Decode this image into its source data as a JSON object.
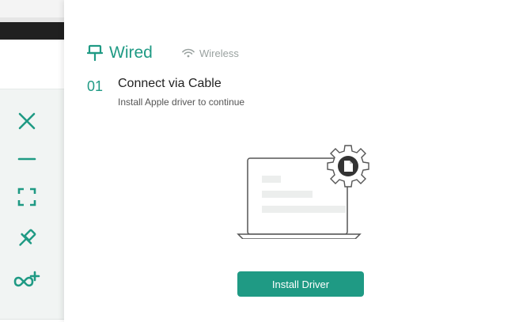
{
  "tabs": {
    "wired_label": "Wired",
    "wireless_label": "Wireless"
  },
  "step": {
    "number": "01",
    "title": "Connect via Cable",
    "subtitle": "Install Apple driver to continue"
  },
  "action": {
    "install_label": "Install Driver"
  },
  "sidebar": {
    "icons": [
      "close-icon",
      "minimize-icon",
      "fullscreen-icon",
      "pin-icon",
      "link-add-icon"
    ]
  },
  "colors": {
    "accent": "#1f9a84",
    "muted": "#9aa2a0"
  }
}
